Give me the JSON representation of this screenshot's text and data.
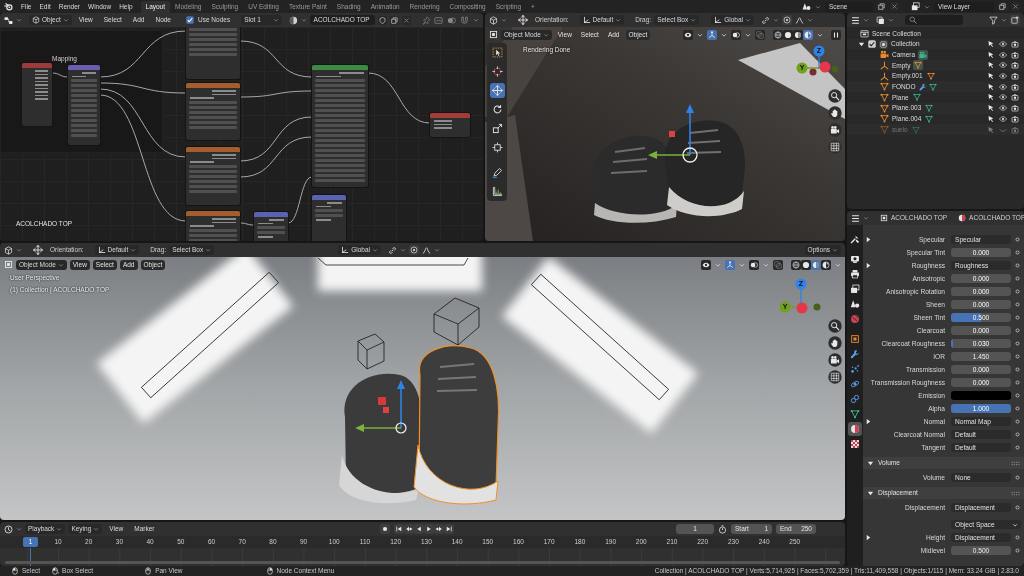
{
  "top_bar": {
    "menus": [
      "File",
      "Edit",
      "Render",
      "Window",
      "Help"
    ],
    "workspaces": [
      {
        "label": "Layout",
        "selected": true
      },
      {
        "label": "Modeling",
        "selected": false
      },
      {
        "label": "Sculpting",
        "selected": false
      },
      {
        "label": "UV Editing",
        "selected": false
      },
      {
        "label": "Texture Paint",
        "selected": false
      },
      {
        "label": "Shading",
        "selected": false
      },
      {
        "label": "Animation",
        "selected": false
      },
      {
        "label": "Rendering",
        "selected": false
      },
      {
        "label": "Compositing",
        "selected": false
      },
      {
        "label": "Scripting",
        "selected": false
      }
    ],
    "add_workspace": "+",
    "scene": "Scene",
    "view_layer": "View Layer"
  },
  "node_editor": {
    "header": {
      "object_type": "Object",
      "menus": [
        "View",
        "Select",
        "Add",
        "Node"
      ],
      "use_nodes": {
        "label": "Use Nodes",
        "checked": true
      },
      "slot": "Slot 1",
      "material": "ACOLCHADO TOP"
    },
    "nodes": [
      {
        "kind": "texture_coordinate",
        "color": "#9b3b3b"
      },
      {
        "kind": "mapping",
        "color": "#6b5eb0",
        "label": "Mapping"
      },
      {
        "kind": "image_texture"
      },
      {
        "kind": "image_texture",
        "color": "#a55e2b"
      },
      {
        "kind": "image_texture",
        "color": "#a55e2b"
      },
      {
        "kind": "image_texture",
        "color": "#a55e2b"
      },
      {
        "kind": "principled_bsdf",
        "color": "#3d8a45"
      },
      {
        "kind": "material_output",
        "color": "#a33b3b"
      },
      {
        "kind": "normal_map",
        "color": "#5a63b0"
      },
      {
        "kind": "normal_map",
        "color": "#5a63b0"
      }
    ],
    "material_label": "ACOLCHADO TOP"
  },
  "viewport_top": {
    "tool_settings": {
      "orientation_label": "Orientation:",
      "orientation": "Default",
      "drag_label": "Drag:",
      "drag": "Select Box",
      "transform_space": "Global"
    },
    "mode": "Object Mode",
    "menus": [
      {
        "label": "View",
        "highlighted": false
      },
      {
        "label": "Select",
        "highlighted": false
      },
      {
        "label": "Add",
        "highlighted": false
      },
      {
        "label": "Object",
        "highlighted": true
      }
    ],
    "status_text": "Rendering Done",
    "tools": [
      {
        "kind": "select_box",
        "selected": false
      },
      {
        "kind": "cursor",
        "selected": false
      },
      {
        "kind": "move",
        "selected": true
      },
      {
        "kind": "rotate",
        "selected": false
      },
      {
        "kind": "scale",
        "selected": false
      },
      {
        "kind": "transform",
        "selected": false
      },
      {
        "kind": "annotate",
        "selected": false
      },
      {
        "kind": "measure",
        "selected": false
      }
    ],
    "shading": [
      {
        "kind": "wireframe",
        "selected": false
      },
      {
        "kind": "solid",
        "selected": false
      },
      {
        "kind": "material",
        "selected": false
      },
      {
        "kind": "rendered",
        "selected": true
      }
    ],
    "gizmo_labels": [
      "Z",
      "Y"
    ]
  },
  "viewport_bottom": {
    "tool_settings": {
      "orientation_label": "Orientation:",
      "orientation": "Default",
      "drag_label": "Drag:",
      "drag": "Select Box",
      "transform_space": "Global",
      "options": "Options"
    },
    "mode": "Object Mode",
    "menus": [
      {
        "label": "View",
        "highlighted": true
      },
      {
        "label": "Select",
        "highlighted": true
      },
      {
        "label": "Add",
        "highlighted": true
      },
      {
        "label": "Object",
        "highlighted": true
      }
    ],
    "view_name": "User Perspective",
    "view_context": "(1) Collection | ACOLCHADO TOP",
    "shading": [
      {
        "kind": "wireframe",
        "selected": false
      },
      {
        "kind": "solid",
        "selected": false
      },
      {
        "kind": "material",
        "selected": true
      },
      {
        "kind": "rendered",
        "selected": false
      }
    ],
    "gizmo_labels": [
      "Z",
      "Y"
    ]
  },
  "outliner": {
    "tree": [
      {
        "name": "Scene Collection",
        "kind": "scene_collection",
        "children": [
          {
            "name": "Collection",
            "kind": "collection",
            "checked": true,
            "expanded": true,
            "visible": true,
            "children": [
              {
                "name": "Camera",
                "kind": "camera",
                "visible": true,
                "data": [
                  {
                    "kind": "camera_data",
                    "highlighted": true
                  }
                ]
              },
              {
                "name": "Empty",
                "kind": "empty",
                "visible": true,
                "data": [
                  {
                    "kind": "child_mesh",
                    "highlighted": true
                  }
                ]
              },
              {
                "name": "Empty.001",
                "kind": "empty",
                "visible": true,
                "data": [
                  {
                    "kind": "child_mesh",
                    "highlighted": false
                  }
                ]
              },
              {
                "name": "FONDO",
                "kind": "mesh",
                "visible": true,
                "data": [
                  {
                    "kind": "modifier",
                    "highlighted": false
                  },
                  {
                    "kind": "mesh_data",
                    "highlighted": false
                  }
                ]
              },
              {
                "name": "Plane",
                "kind": "mesh",
                "visible": true,
                "data": [
                  {
                    "kind": "mesh_data",
                    "highlighted": false
                  }
                ]
              },
              {
                "name": "Plane.003",
                "kind": "mesh",
                "visible": true,
                "data": [
                  {
                    "kind": "mesh_data",
                    "highlighted": false
                  }
                ]
              },
              {
                "name": "Plane.004",
                "kind": "mesh",
                "visible": true,
                "data": [
                  {
                    "kind": "mesh_data",
                    "highlighted": false
                  }
                ]
              },
              {
                "name": "suelo",
                "kind": "mesh",
                "visible": false,
                "data": [
                  {
                    "kind": "mesh_data",
                    "highlighted": false
                  }
                ]
              }
            ]
          }
        ]
      }
    ]
  },
  "properties": {
    "header": {
      "object": "ACOLCHADO TOP",
      "material": "ACOLCHADO TOP"
    },
    "tabs": [
      {
        "kind": "tool",
        "selected": false
      },
      {
        "kind": "render",
        "selected": false
      },
      {
        "kind": "output",
        "selected": false
      },
      {
        "kind": "view_layer",
        "selected": false
      },
      {
        "kind": "scene",
        "selected": false
      },
      {
        "kind": "world",
        "selected": false
      },
      {
        "kind": "object",
        "selected": false
      },
      {
        "kind": "modifiers",
        "selected": false
      },
      {
        "kind": "particles",
        "selected": false
      },
      {
        "kind": "physics",
        "selected": false
      },
      {
        "kind": "constraints",
        "selected": false
      },
      {
        "kind": "data",
        "selected": false
      },
      {
        "kind": "material",
        "selected": true
      },
      {
        "kind": "texture",
        "selected": false
      }
    ],
    "rows": [
      {
        "kind": "link",
        "label": "Specular",
        "value": "Specular",
        "expanded": false
      },
      {
        "kind": "slider",
        "label": "Specular Tint",
        "value": "0.000",
        "level": 0
      },
      {
        "kind": "link",
        "label": "Roughness",
        "value": "Roughness",
        "expanded": false
      },
      {
        "kind": "slider",
        "label": "Anisotropic",
        "value": "0.000",
        "level": 0
      },
      {
        "kind": "slider",
        "label": "Anisotropic Rotation",
        "value": "0.000",
        "level": 0
      },
      {
        "kind": "slider",
        "label": "Sheen",
        "value": "0.000",
        "level": 0
      },
      {
        "kind": "slider",
        "label": "Sheen Tint",
        "value": "0.500",
        "level": 0.5
      },
      {
        "kind": "slider",
        "label": "Clearcoat",
        "value": "0.000",
        "level": 0
      },
      {
        "kind": "slider",
        "label": "Clearcoat Roughness",
        "value": "0.030",
        "level": 0.03
      },
      {
        "kind": "number",
        "label": "IOR",
        "value": "1.450"
      },
      {
        "kind": "slider",
        "label": "Transmission",
        "value": "0.000",
        "level": 0
      },
      {
        "kind": "slider",
        "label": "Transmission Roughness",
        "value": "0.000",
        "level": 0
      },
      {
        "kind": "color",
        "label": "Emission",
        "color": "#000000"
      },
      {
        "kind": "slider",
        "label": "Alpha",
        "value": "1.000",
        "level": 1
      },
      {
        "kind": "link",
        "label": "Normal",
        "value": "Normal Map",
        "expanded": false
      },
      {
        "kind": "link",
        "label": "Clearcoat Normal",
        "value": "Default"
      },
      {
        "kind": "link",
        "label": "Tangent",
        "value": "Default"
      }
    ],
    "panels": [
      {
        "title": "Volume",
        "expanded": true,
        "rows": [
          {
            "kind": "link",
            "label": "Volume",
            "value": "None"
          }
        ]
      },
      {
        "title": "Displacement",
        "expanded": true,
        "rows": [
          {
            "kind": "link",
            "label": "Displacement",
            "value": "Displacement"
          },
          {
            "kind": "dropdown",
            "value": "Object Space"
          },
          {
            "kind": "link",
            "label": "Height",
            "value": "Displacement",
            "expanded": false
          },
          {
            "kind": "number",
            "label": "Midlevel",
            "value": "0.500"
          }
        ]
      }
    ]
  },
  "timeline": {
    "menus": [
      {
        "label": "Playback",
        "dropdown": true
      },
      {
        "label": "Keying",
        "dropdown": true
      },
      {
        "label": "View",
        "dropdown": false
      },
      {
        "label": "Marker",
        "dropdown": false
      }
    ],
    "current_frame": "1",
    "start_label": "Start",
    "start": "1",
    "end_label": "End",
    "end": "250",
    "playhead": "1",
    "ruler": [
      "10",
      "20",
      "30",
      "40",
      "50",
      "60",
      "70",
      "80",
      "90",
      "100",
      "110",
      "120",
      "130",
      "140",
      "150",
      "160",
      "170",
      "180",
      "190",
      "200",
      "210",
      "220",
      "230",
      "240",
      "250"
    ]
  },
  "status_bar": {
    "hints": [
      {
        "kind": "mouse_left",
        "label": "Select"
      },
      {
        "kind": "mouse_drag",
        "label": "Box Select"
      },
      {
        "kind": "mouse_middle",
        "label": "Pan View"
      },
      {
        "kind": "mouse_right",
        "label": "Node Context Menu"
      }
    ],
    "stats": "Collection | ACOLCHADO TOP | Verts:5,714,925 | Faces:5,702,359 | Tris:11,409,558 | Objects:1/115 | Mem: 33.24 GiB | 2.83.0"
  }
}
